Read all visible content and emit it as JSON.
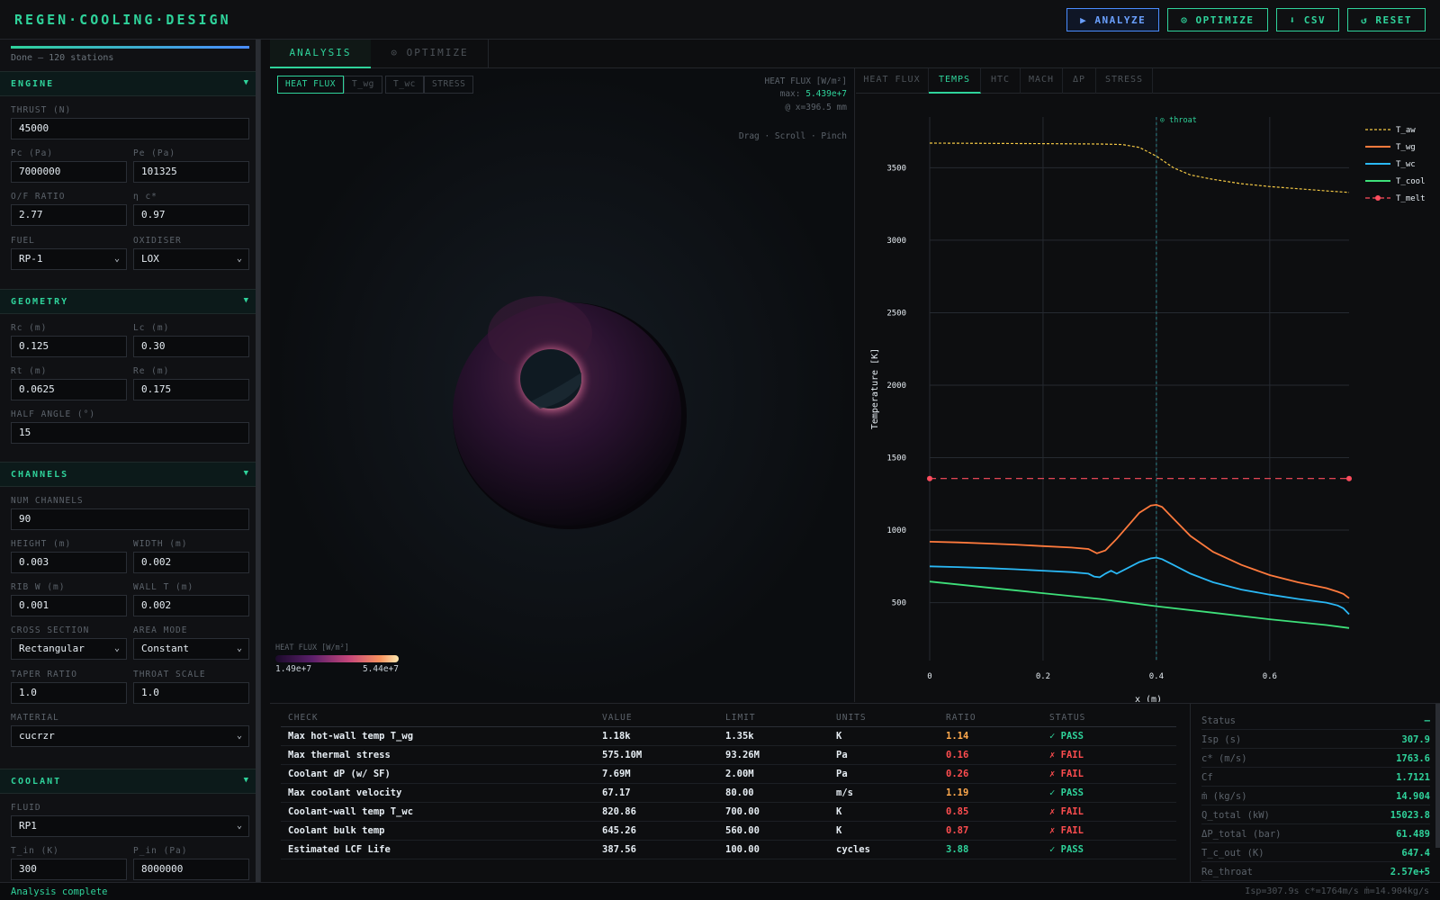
{
  "app": {
    "title": "REGEN·COOLING·DESIGN"
  },
  "toolbar": {
    "analyze_label": "▶ ANALYZE",
    "optimize_label": "⊙ OPTIMIZE",
    "csv_label": "⬇ CSV",
    "reset_label": "↺ RESET"
  },
  "progress": {
    "fraction": 1.0,
    "text": "Done — 120 stations"
  },
  "engine": {
    "title": "ENGINE",
    "thrust_label": "THRUST (N)",
    "thrust": "45000",
    "pc_label": "Pc (Pa)",
    "pc": "7000000",
    "pe_label": "Pe (Pa)",
    "pe": "101325",
    "of_label": "O/F RATIO",
    "of": "2.77",
    "eta_label": "η c*",
    "eta": "0.97",
    "fuel_label": "FUEL",
    "fuel": "RP-1",
    "ox_label": "OXIDISER",
    "ox": "LOX"
  },
  "geometry": {
    "title": "GEOMETRY",
    "rc_label": "Rc (m)",
    "rc": "0.125",
    "lc_label": "Lc (m)",
    "lc": "0.30",
    "rt_label": "Rt (m)",
    "rt": "0.0625",
    "re_label": "Re (m)",
    "re": "0.175",
    "half_label": "HALF ANGLE (°)",
    "half": "15"
  },
  "channels": {
    "title": "CHANNELS",
    "num_label": "NUM CHANNELS",
    "num": "90",
    "height_label": "HEIGHT (m)",
    "height": "0.003",
    "width_label": "WIDTH (m)",
    "width": "0.002",
    "rib_label": "RIB W (m)",
    "rib": "0.001",
    "wall_label": "WALL T (m)",
    "wall": "0.002",
    "cross_label": "CROSS SECTION",
    "cross": "Rectangular",
    "area_label": "AREA MODE",
    "area": "Constant",
    "taper_label": "TAPER RATIO",
    "taper": "1.0",
    "throat_label": "THROAT SCALE",
    "throat": "1.0",
    "material_label": "MATERIAL",
    "material": "cucrzr"
  },
  "coolant": {
    "title": "COOLANT",
    "fluid_label": "FLUID",
    "fluid": "RP1",
    "tin_label": "T_in (K)",
    "tin": "300",
    "pin_label": "P_in (Pa)",
    "pin": "8000000"
  },
  "main_tabs": {
    "analysis": "ANALYSIS",
    "optimize": "⊙ OPTIMIZE"
  },
  "viewer": {
    "tabs": [
      "HEAT FLUX",
      "T_wg",
      "T_wc",
      "STRESS"
    ],
    "info_title": "HEAT FLUX [W/m²]",
    "info_max_label": "max:",
    "info_max": "5.439e+7",
    "info_at": "@ x=396.5 mm",
    "hint": "Drag · Scroll · Pinch",
    "legend_title": "HEAT FLUX [W/m²]",
    "legend_min": "1.49e+7",
    "legend_max": "5.44e+7"
  },
  "chart_tabs": [
    "HEAT FLUX",
    "TEMPS",
    "HTC",
    "MACH",
    "ΔP",
    "STRESS"
  ],
  "chart_data": {
    "type": "line",
    "xlabel": "x (m)",
    "ylabel": "Temperature [K]",
    "xlim": [
      0,
      0.74
    ],
    "ylim": [
      100,
      3850
    ],
    "xticks": [
      0,
      0.2,
      0.4,
      0.6
    ],
    "xtick_labels": [
      "0",
      "0.2",
      "0.4",
      "0.6"
    ],
    "yticks": [
      500,
      1000,
      1500,
      2000,
      2500,
      3000,
      3500
    ],
    "ytick_labels": [
      "500",
      "1000",
      "1500",
      "2000",
      "2500",
      "3000",
      "3500"
    ],
    "grid": true,
    "legend_position": "top-right",
    "annotation": {
      "label": "⊙ throat",
      "x": 0.4
    },
    "series": [
      {
        "name": "T_aw",
        "color": "#f2c744",
        "dash": "dotted",
        "x": [
          0,
          0.1,
          0.2,
          0.3,
          0.34,
          0.37,
          0.4,
          0.43,
          0.46,
          0.5,
          0.55,
          0.6,
          0.65,
          0.7,
          0.74
        ],
        "y": [
          3670,
          3668,
          3666,
          3664,
          3660,
          3640,
          3580,
          3500,
          3450,
          3420,
          3390,
          3370,
          3355,
          3340,
          3330
        ]
      },
      {
        "name": "T_wg",
        "color": "#ff7a3d",
        "dash": "solid",
        "x": [
          0,
          0.05,
          0.1,
          0.15,
          0.2,
          0.25,
          0.28,
          0.295,
          0.31,
          0.32,
          0.33,
          0.35,
          0.37,
          0.39,
          0.4,
          0.41,
          0.43,
          0.46,
          0.5,
          0.55,
          0.6,
          0.65,
          0.7,
          0.72,
          0.73,
          0.74
        ],
        "y": [
          920,
          915,
          908,
          900,
          890,
          880,
          870,
          840,
          860,
          900,
          940,
          1030,
          1120,
          1170,
          1175,
          1160,
          1080,
          960,
          850,
          760,
          690,
          640,
          600,
          575,
          560,
          530
        ]
      },
      {
        "name": "T_wc",
        "color": "#2ab8f5",
        "dash": "solid",
        "x": [
          0,
          0.05,
          0.1,
          0.15,
          0.2,
          0.25,
          0.28,
          0.29,
          0.3,
          0.31,
          0.32,
          0.33,
          0.35,
          0.37,
          0.39,
          0.4,
          0.41,
          0.43,
          0.46,
          0.5,
          0.55,
          0.6,
          0.65,
          0.7,
          0.72,
          0.73,
          0.74
        ],
        "y": [
          750,
          745,
          738,
          730,
          720,
          710,
          700,
          680,
          675,
          700,
          720,
          700,
          740,
          780,
          805,
          810,
          800,
          760,
          700,
          640,
          590,
          555,
          525,
          500,
          480,
          460,
          420
        ]
      },
      {
        "name": "T_cool",
        "color": "#3ee07a",
        "dash": "solid",
        "x": [
          0,
          0.1,
          0.2,
          0.3,
          0.4,
          0.5,
          0.6,
          0.7,
          0.74
        ],
        "y": [
          645,
          605,
          565,
          525,
          475,
          430,
          385,
          345,
          325
        ]
      },
      {
        "name": "T_melt",
        "color": "#ff4d5e",
        "dash": "dashed",
        "markers": true,
        "x": [
          0,
          0.74
        ],
        "y": [
          1356,
          1356
        ]
      }
    ]
  },
  "checks": {
    "headers": [
      "CHECK",
      "VALUE",
      "LIMIT",
      "UNITS",
      "RATIO",
      "STATUS"
    ],
    "rows": [
      {
        "check": "Max hot-wall temp T_wg",
        "value": "1.18k",
        "limit": "1.35k",
        "units": "K",
        "ratio": "1.14",
        "status": "✓ PASS",
        "pass": true,
        "ratio_style": "warn"
      },
      {
        "check": "Max thermal stress",
        "value": "575.10M",
        "limit": "93.26M",
        "units": "Pa",
        "ratio": "0.16",
        "status": "✗ FAIL",
        "pass": false,
        "ratio_style": "fail"
      },
      {
        "check": "Coolant dP (w/ SF)",
        "value": "7.69M",
        "limit": "2.00M",
        "units": "Pa",
        "ratio": "0.26",
        "status": "✗ FAIL",
        "pass": false,
        "ratio_style": "fail"
      },
      {
        "check": "Max coolant velocity",
        "value": "67.17",
        "limit": "80.00",
        "units": "m/s",
        "ratio": "1.19",
        "status": "✓ PASS",
        "pass": true,
        "ratio_style": "warn"
      },
      {
        "check": "Coolant-wall temp T_wc",
        "value": "820.86",
        "limit": "700.00",
        "units": "K",
        "ratio": "0.85",
        "status": "✗ FAIL",
        "pass": false,
        "ratio_style": "fail"
      },
      {
        "check": "Coolant bulk temp",
        "value": "645.26",
        "limit": "560.00",
        "units": "K",
        "ratio": "0.87",
        "status": "✗ FAIL",
        "pass": false,
        "ratio_style": "fail"
      },
      {
        "check": "Estimated LCF Life",
        "value": "387.56",
        "limit": "100.00",
        "units": "cycles",
        "ratio": "3.88",
        "status": "✓ PASS",
        "pass": true,
        "ratio_style": "good"
      }
    ]
  },
  "metrics": [
    {
      "k": "Status",
      "v": "—"
    },
    {
      "k": "Isp (s)",
      "v": "307.9"
    },
    {
      "k": "c* (m/s)",
      "v": "1763.6"
    },
    {
      "k": "Cf",
      "v": "1.7121"
    },
    {
      "k": "ṁ (kg/s)",
      "v": "14.904"
    },
    {
      "k": "Q_total (kW)",
      "v": "15023.8"
    },
    {
      "k": "ΔP_total (bar)",
      "v": "61.489"
    },
    {
      "k": "T_c_out (K)",
      "v": "647.4"
    },
    {
      "k": "Re_throat",
      "v": "2.57e+5"
    }
  ],
  "statusbar": {
    "left": "Analysis complete",
    "right": "Isp=307.9s c*=1764m/s ṁ=14.904kg/s"
  }
}
